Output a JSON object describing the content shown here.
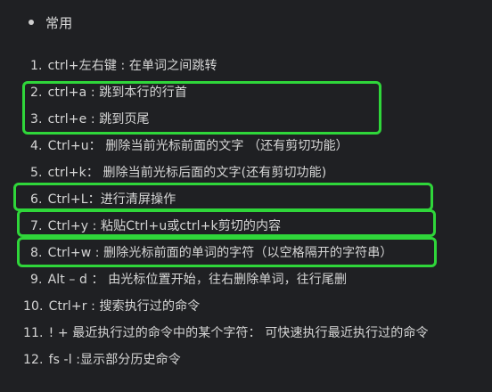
{
  "section": {
    "title": "常用"
  },
  "items": [
    {
      "num": "1.",
      "text": "ctrl+左右键 : 在单词之间跳转"
    },
    {
      "num": "2.",
      "text": "ctrl+a : 跳到本行的行首"
    },
    {
      "num": "3.",
      "text": "ctrl+e : 跳到页尾"
    },
    {
      "num": "4.",
      "text": "Ctrl+u：  删除当前光标前面的文字 （还有剪切功能）"
    },
    {
      "num": "5.",
      "text": "ctrl+k：  删除当前光标后面的文字(还有剪切功能)"
    },
    {
      "num": "6.",
      "text": "Ctrl+L：进行清屏操作"
    },
    {
      "num": "7.",
      "text": "Ctrl+y : 粘贴Ctrl+u或ctrl+k剪切的内容"
    },
    {
      "num": "8.",
      "text": "Ctrl+w : 删除光标前面的单词的字符（以空格隔开的字符串）"
    },
    {
      "num": "9.",
      "text": "Alt – d ：  由光标位置开始，往右删除单词，往行尾删"
    },
    {
      "num": "10.",
      "text": "Ctrl+r : 搜索执行过的命令"
    },
    {
      "num": "11.",
      "text": "! + 最近执行过的命令中的某个字符：  可快速执行最近执行过的命令"
    },
    {
      "num": "12.",
      "text": "fs -l :显示部分历史命令"
    }
  ],
  "colors": {
    "background": "#1f2023",
    "text": "#d6d6d6",
    "highlight_box": "#2fd63a"
  }
}
